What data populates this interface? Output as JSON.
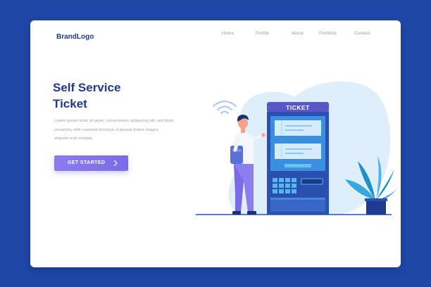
{
  "header": {
    "brand": "BrandLogo",
    "nav": [
      {
        "label": "Home"
      },
      {
        "label": "Profile"
      },
      {
        "label": "About"
      },
      {
        "label": "Portfolio"
      },
      {
        "label": "Contact"
      }
    ]
  },
  "hero": {
    "title_line1": "Self Service",
    "title_line2": "Ticket",
    "description_lines": [
      "Lorem ipsum dolor sit amet, consectetuer adipiscing elit, sed diam",
      "nonummy nibh euismod tincidunt ut laoreet dolore magna",
      "aliquam erat volutpat."
    ],
    "cta_label": "GET STARTED"
  },
  "illustration": {
    "kiosk_label": "TICKET",
    "icons": [
      "wifi-icon",
      "chevron-right-icon"
    ]
  },
  "colors": {
    "page_background": "#1f47a8",
    "brand_text": "#1e3a8a",
    "cta_start": "#8b7cf0",
    "cta_end": "#7a6bea",
    "kiosk": "#2a4fb0",
    "blob": "#dfeefb"
  }
}
